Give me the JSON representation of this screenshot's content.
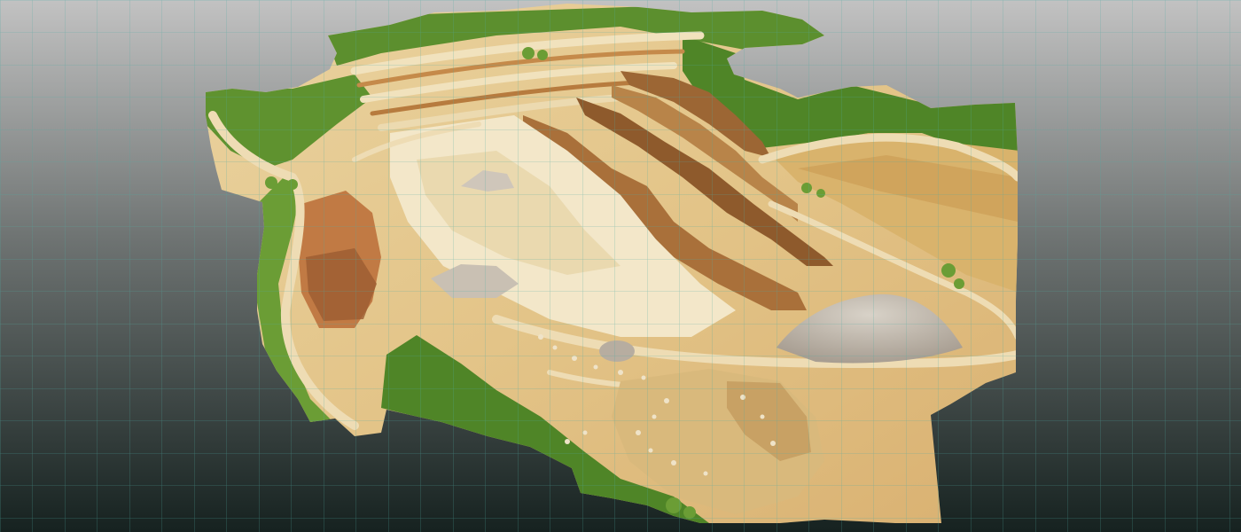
{
  "scene": {
    "subject": "orthomosaic-of-quarry",
    "background": {
      "top_color": "#c2c2c2",
      "bottom_color": "#162220"
    },
    "grid": {
      "visible": true,
      "color": "#4fa9a2"
    },
    "colors": {
      "vegetation": "#5c8f2e",
      "vegetation_light": "#8cb84a",
      "sand": "#e6c98f",
      "sand_light": "#f1e2bd",
      "rock": "#c58a4a",
      "rock_dark": "#8e5a2c",
      "gravel": "#bdb3a6"
    }
  }
}
